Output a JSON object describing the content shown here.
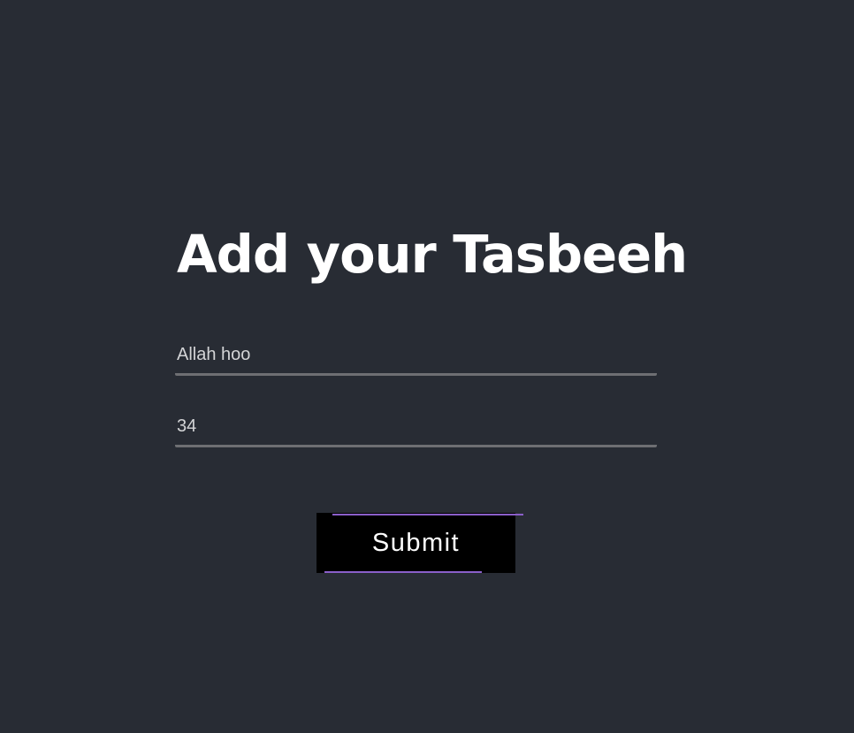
{
  "form": {
    "title": "Add your Tasbeeh",
    "name_value": "Allah hoo",
    "count_value": "34",
    "submit_label": "Submit"
  },
  "colors": {
    "background": "#282c34",
    "title": "#ffffff",
    "input_text": "#d3d4d6",
    "input_underline": "#6e6f73",
    "button_bg": "#000000",
    "button_accent": "#8a5fc9"
  }
}
